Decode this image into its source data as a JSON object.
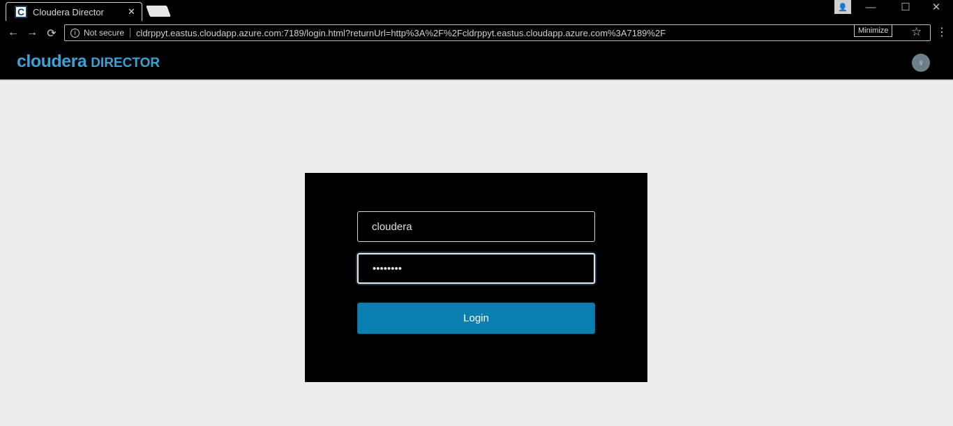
{
  "browser": {
    "tab_title": "Cloudera Director",
    "tab_favicon": "C",
    "tab_close": "✕",
    "profile_icon": "person-icon",
    "minimize_symbol": "—",
    "maximize_symbol": "☐",
    "close_symbol": "✕",
    "back_symbol": "←",
    "forward_symbol": "→",
    "reload_symbol": "⟳",
    "info_symbol": "i",
    "not_secure_label": "Not secure",
    "url": "cldrppyt.eastus.cloudapp.azure.com:7189/login.html?returnUrl=http%3A%2F%2Fcldrppyt.eastus.cloudapp.azure.com%3A7189%2F",
    "tooltip": "Minimize",
    "star_symbol": "☆",
    "menu_symbol": "⋮"
  },
  "header": {
    "logo_main": "cloudera",
    "logo_sub": "DIRECTOR",
    "avatar_glyph": "♀"
  },
  "login": {
    "username_value": "cloudera",
    "password_value": "cloudera",
    "button_label": "Login"
  },
  "colors": {
    "accent": "#0a7fb0",
    "logo": "#3aa3d6",
    "page_bg": "#eaeef1"
  }
}
